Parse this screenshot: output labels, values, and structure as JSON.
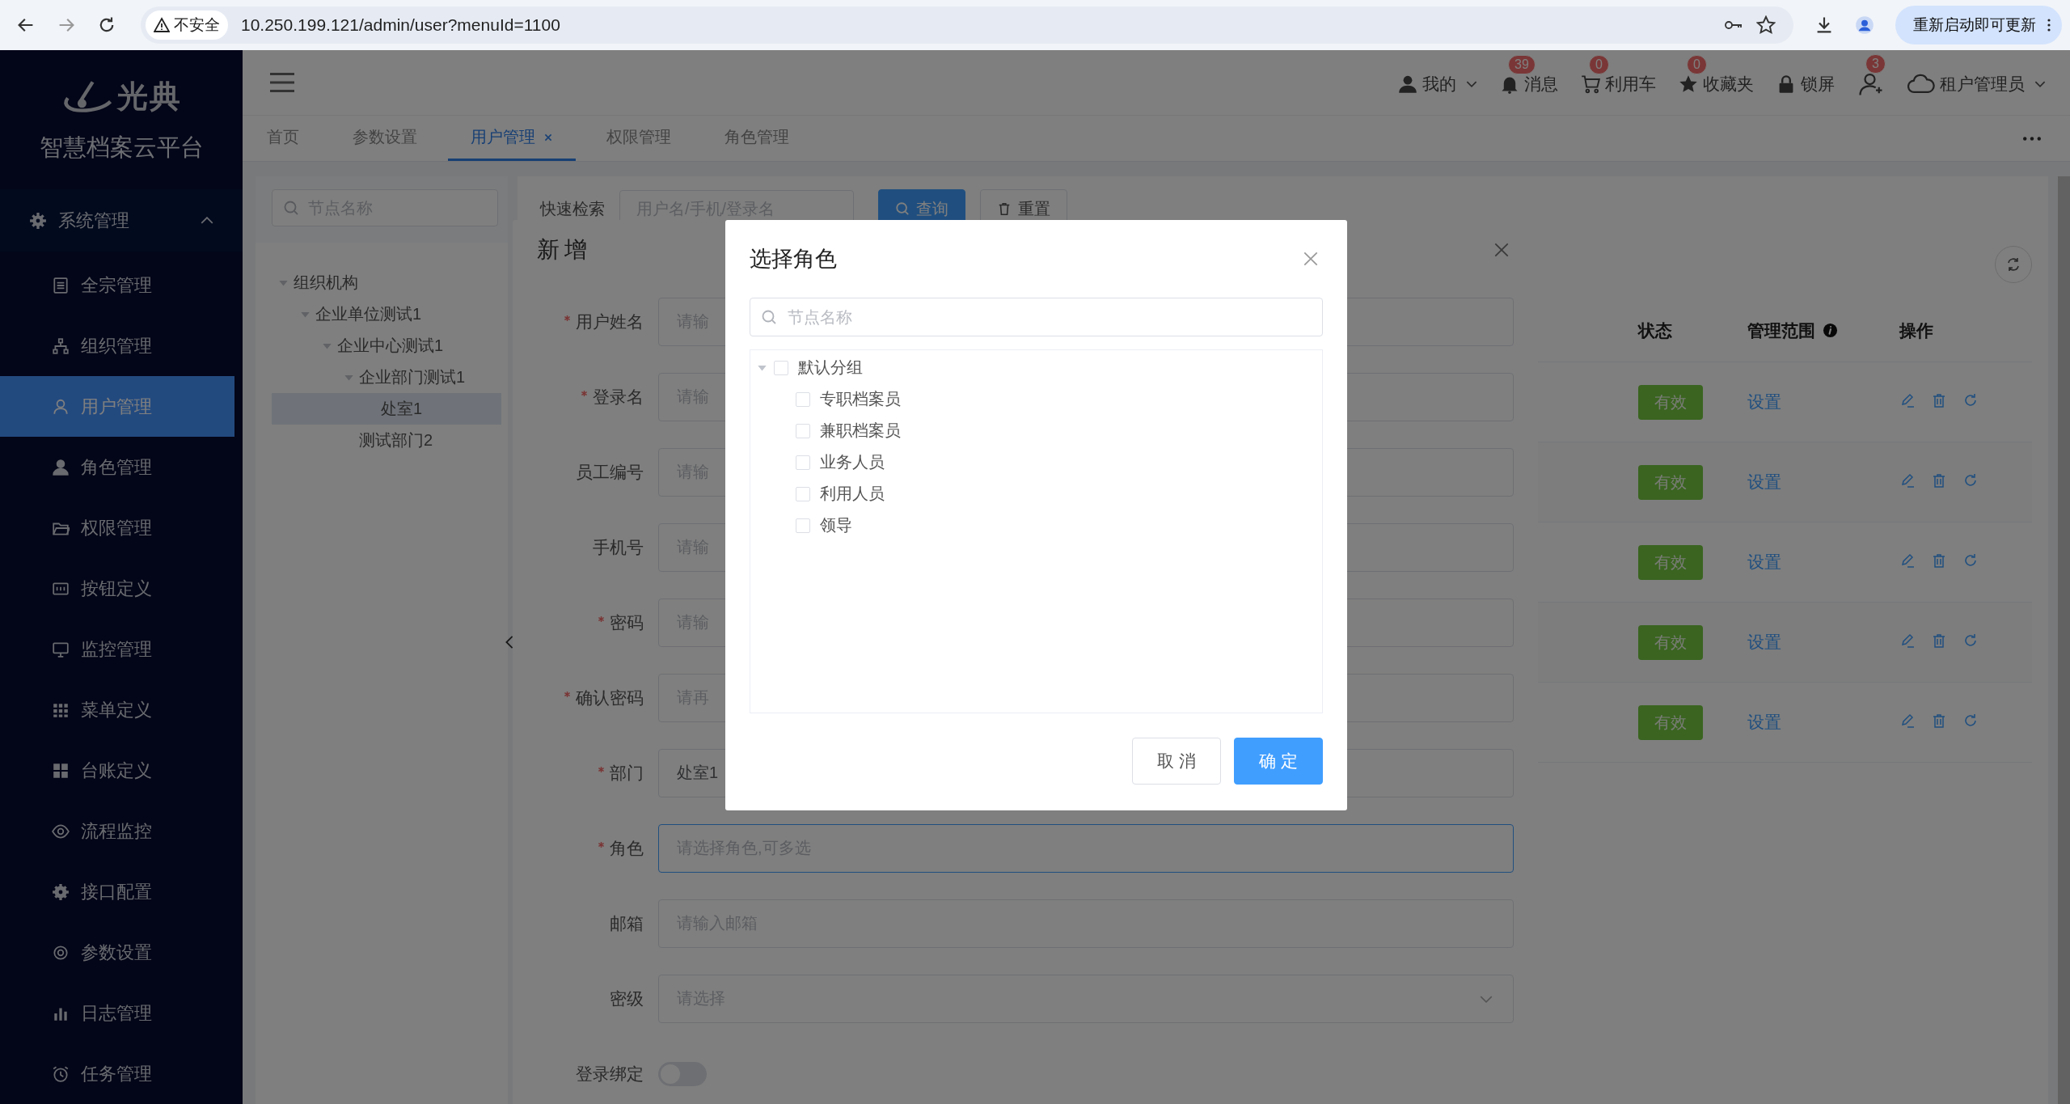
{
  "browser": {
    "security": "不安全",
    "url": "10.250.199.121/admin/user?menuId=1100",
    "update_button": "重新启动即可更新"
  },
  "logo": {
    "brand": "光典",
    "subtitle": "智慧档案云平台"
  },
  "sidebar": {
    "group": {
      "label": "系统管理",
      "expanded": true
    },
    "items": [
      {
        "label": "全宗管理",
        "selected": false
      },
      {
        "label": "组织管理",
        "selected": false
      },
      {
        "label": "用户管理",
        "selected": true
      },
      {
        "label": "角色管理",
        "selected": false
      },
      {
        "label": "权限管理",
        "selected": false
      },
      {
        "label": "按钮定义",
        "selected": false
      },
      {
        "label": "监控管理",
        "selected": false
      },
      {
        "label": "菜单定义",
        "selected": false
      },
      {
        "label": "台账定义",
        "selected": false
      },
      {
        "label": "流程监控",
        "selected": false
      },
      {
        "label": "接口配置",
        "selected": false
      },
      {
        "label": "参数设置",
        "selected": false
      },
      {
        "label": "日志管理",
        "selected": false
      },
      {
        "label": "任务管理",
        "selected": false
      }
    ]
  },
  "header": {
    "items": [
      {
        "label": "我的",
        "dropdown": true
      },
      {
        "label": "消息",
        "badge": "39",
        "dropdown": false
      },
      {
        "label": "利用车",
        "badge": "0",
        "dropdown": false
      },
      {
        "label": "收藏夹",
        "badge": "0",
        "dropdown": false
      },
      {
        "label": "锁屏",
        "dropdown": false
      },
      {
        "badge": "3",
        "dropdown": false
      },
      {
        "label": "租户管理员",
        "dropdown": true
      }
    ]
  },
  "tabs": [
    {
      "label": "首页",
      "selected": false,
      "closable": false
    },
    {
      "label": "参数设置",
      "selected": false,
      "closable": false
    },
    {
      "label": "用户管理",
      "selected": true,
      "closable": true
    },
    {
      "label": "权限管理",
      "selected": false,
      "closable": false
    },
    {
      "label": "角色管理",
      "selected": false,
      "closable": false
    }
  ],
  "tree": {
    "search_placeholder": "节点名称",
    "nodes": [
      {
        "label": "组织机构",
        "expanded": true,
        "selected": false,
        "children": [
          {
            "label": "企业单位测试1",
            "expanded": true,
            "selected": false,
            "children": [
              {
                "label": "企业中心测试1",
                "expanded": true,
                "selected": false,
                "children": [
                  {
                    "label": "企业部门测试1",
                    "expanded": true,
                    "selected": false,
                    "children": [
                      {
                        "label": "处室1",
                        "selected": true
                      }
                    ]
                  },
                  {
                    "label": "测试部门2",
                    "selected": false
                  }
                ]
              }
            ]
          }
        ]
      }
    ]
  },
  "quick_search": {
    "label": "快速检索",
    "placeholder": "用户名/手机/登录名",
    "buttons": [
      "查询",
      "重置"
    ]
  },
  "table": {
    "columns": [
      "状态",
      "管理范围",
      "操作"
    ],
    "rows": [
      {
        "status": "有效",
        "scope": "设置"
      },
      {
        "status": "有效",
        "scope": "设置"
      },
      {
        "status": "有效",
        "scope": "设置"
      },
      {
        "status": "有效",
        "scope": "设置"
      },
      {
        "status": "有效",
        "scope": "设置"
      }
    ]
  },
  "drawer": {
    "title": "新增",
    "fields": [
      {
        "kind": "input",
        "label": "用户姓名",
        "required": true,
        "focused": false,
        "placeholder": "请输"
      },
      {
        "kind": "input",
        "label": "登录名",
        "required": true,
        "focused": false,
        "placeholder": "请输"
      },
      {
        "kind": "input",
        "label": "员工编号",
        "required": false,
        "focused": false,
        "placeholder": "请输"
      },
      {
        "kind": "input",
        "label": "手机号",
        "required": false,
        "focused": false,
        "placeholder": "请输"
      },
      {
        "kind": "input",
        "label": "密码",
        "required": true,
        "focused": false,
        "placeholder": "请输"
      },
      {
        "kind": "input",
        "label": "确认密码",
        "required": true,
        "focused": false,
        "placeholder": "请再"
      },
      {
        "kind": "input",
        "label": "部门",
        "required": true,
        "focused": false,
        "value": "处室1"
      },
      {
        "kind": "input",
        "label": "角色",
        "required": true,
        "focused": true,
        "placeholder": "请选择角色,可多选"
      },
      {
        "kind": "input",
        "label": "邮箱",
        "required": false,
        "focused": false,
        "placeholder": "请输入邮箱"
      },
      {
        "kind": "select",
        "label": "密级",
        "required": false,
        "focused": false,
        "placeholder": "请选择"
      },
      {
        "kind": "switch",
        "label": "登录绑定",
        "required": false,
        "focused": false,
        "on": false
      }
    ]
  },
  "modal": {
    "title": "选择角色",
    "search_placeholder": "节点名称",
    "tree": [
      {
        "label": "默认分组",
        "expanded": true,
        "checked": false,
        "children": [
          {
            "label": "专职档案员",
            "checked": false
          },
          {
            "label": "兼职档案员",
            "checked": false
          },
          {
            "label": "业务人员",
            "checked": false
          },
          {
            "label": "利用人员",
            "checked": false
          },
          {
            "label": "领导",
            "checked": false
          }
        ]
      }
    ],
    "buttons": [
      {
        "label": "取 消",
        "kind": "secondary"
      },
      {
        "label": "确 定",
        "kind": "primary"
      }
    ]
  }
}
